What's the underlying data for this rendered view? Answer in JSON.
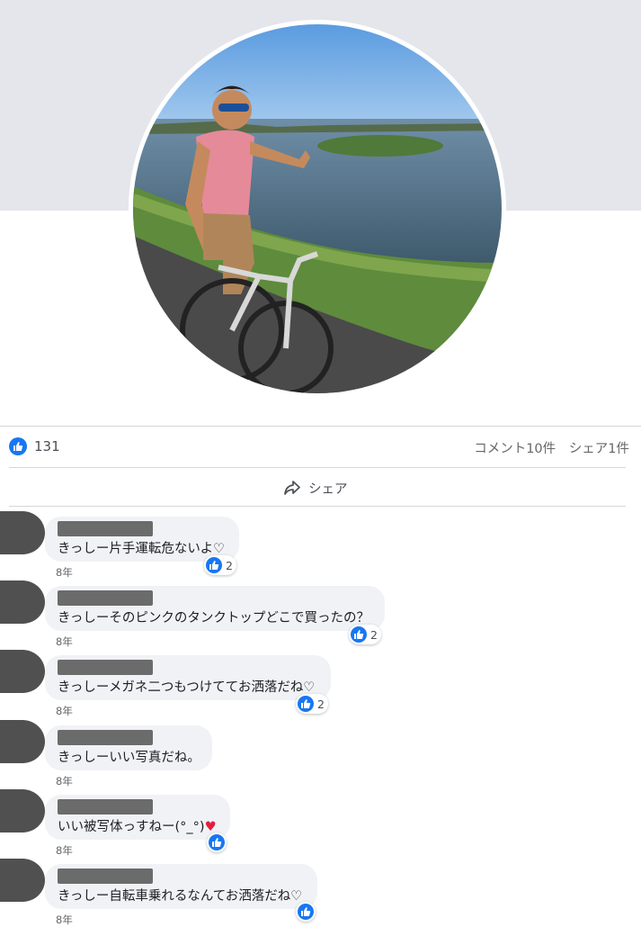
{
  "post": {
    "like_count": "131",
    "comments_summary": "コメント10件",
    "shares_summary": "シェア1件",
    "share_label": "シェア"
  },
  "icons": {
    "like": "thumbs-up-icon",
    "share": "share-arrow-icon",
    "like_color": "#1877f2"
  },
  "comments": [
    {
      "name": "",
      "text": "きっしー片手運転危ないよ♡",
      "time": "8年",
      "reactions": "2"
    },
    {
      "name": "",
      "text": "きっしーそのピンクのタンクトップどこで買ったの？",
      "time": "8年",
      "reactions": "2"
    },
    {
      "name": "",
      "text": "きっしーメガネ二つもつけててお洒落だね♡",
      "time": "8年",
      "reactions": "2"
    },
    {
      "name": "",
      "text": "きっしーいい写真だね。",
      "time": "8年",
      "reactions": ""
    },
    {
      "name": "",
      "text": "いい被写体っすねー(°_°)",
      "time": "8年",
      "reactions": ""
    },
    {
      "name": "",
      "text": "きっしー自転車乗れるなんてお洒落だね♡",
      "time": "8年",
      "reactions": ""
    }
  ]
}
